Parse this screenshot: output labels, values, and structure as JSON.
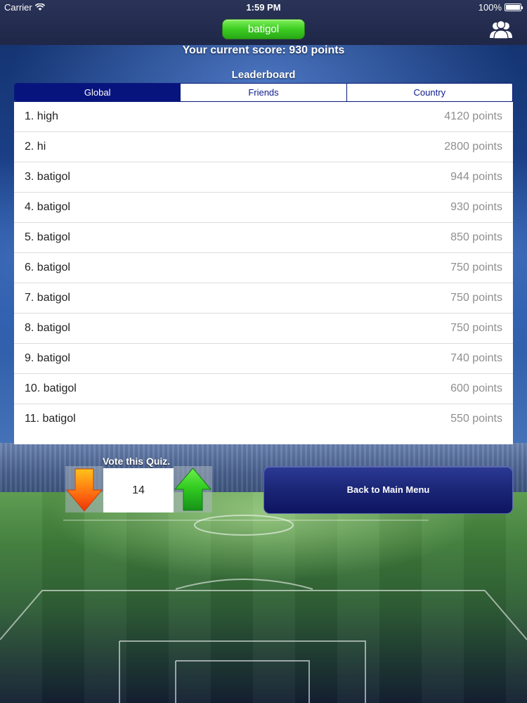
{
  "status_bar": {
    "carrier": "Carrier",
    "time": "1:59 PM",
    "battery": "100%"
  },
  "nav": {
    "username": "batigol",
    "friends_icon": "friends-icon"
  },
  "score": {
    "text": "Your current score: 930 points"
  },
  "leaderboard": {
    "title": "Leaderboard",
    "tabs": [
      {
        "label": "Global",
        "active": true
      },
      {
        "label": "Friends",
        "active": false
      },
      {
        "label": "Country",
        "active": false
      }
    ],
    "rows": [
      {
        "name": "1. high",
        "points": "4120 points"
      },
      {
        "name": "2. hi",
        "points": "2800 points"
      },
      {
        "name": "3. batigol",
        "points": "944 points"
      },
      {
        "name": "4. batigol",
        "points": "930 points"
      },
      {
        "name": "5. batigol",
        "points": "850 points"
      },
      {
        "name": "6. batigol",
        "points": "750 points"
      },
      {
        "name": "7. batigol",
        "points": "750 points"
      },
      {
        "name": "8. batigol",
        "points": "750 points"
      },
      {
        "name": "9. batigol",
        "points": "740 points"
      },
      {
        "name": "10. batigol",
        "points": "600 points"
      },
      {
        "name": "11. batigol",
        "points": "550 points"
      }
    ]
  },
  "vote": {
    "label": "Vote this Quiz.",
    "count": "14",
    "down_icon": "arrow-down-icon",
    "up_icon": "arrow-up-icon"
  },
  "actions": {
    "back_label": "Back to Main Menu"
  },
  "colors": {
    "nav_bg": "#1f2748",
    "pill_green": "#3dcc22",
    "segment_active": "#08147e",
    "button_blue": "#1c2778"
  }
}
